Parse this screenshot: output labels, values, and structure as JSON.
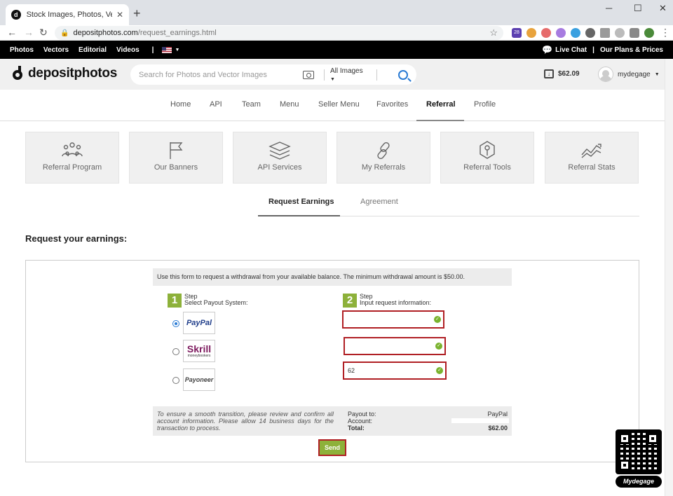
{
  "browser": {
    "tab_title": "Stock Images, Photos, Vectors, Illu",
    "tab_close": "✕",
    "new_tab": "+",
    "url_domain": "depositphotos.com",
    "url_path": "/request_earnings.html",
    "ext_badge": "28"
  },
  "topstrip": {
    "links": [
      "Photos",
      "Vectors",
      "Editorial",
      "Videos"
    ],
    "separator": "|",
    "live_chat": "Live Chat",
    "plans": "Our Plans & Prices"
  },
  "header": {
    "logo": "depositphotos",
    "search_placeholder": "Search for Photos and Vector Images",
    "filter": "All Images",
    "balance": "$62.09",
    "username": "mydegage"
  },
  "nav": {
    "items": [
      "Home",
      "API",
      "Team",
      "Menu",
      "Seller Menu",
      "Favorites",
      "Referral",
      "Profile"
    ],
    "active": "Referral"
  },
  "cards": [
    {
      "label": "Referral Program",
      "icon": "people-icon"
    },
    {
      "label": "Our Banners",
      "icon": "flag-icon"
    },
    {
      "label": "API Services",
      "icon": "layers-icon"
    },
    {
      "label": "My Referrals",
      "icon": "link-icon"
    },
    {
      "label": "Referral Tools",
      "icon": "tools-icon"
    },
    {
      "label": "Referral Stats",
      "icon": "chart-icon"
    }
  ],
  "subtabs": {
    "request": "Request Earnings",
    "agreement": "Agreement"
  },
  "form": {
    "heading": "Request your earnings:",
    "notice": "Use this form to request a withdrawal from your available balance. The minimum withdrawal amount is $50.00.",
    "step1": {
      "num": "1",
      "label": "Step",
      "desc": "Select Payout System:"
    },
    "step2": {
      "num": "2",
      "label": "Step",
      "desc": "Input request information:"
    },
    "payout_systems": [
      "PayPal",
      "Skrill",
      "Payoneer"
    ],
    "skrill_sub": "moneybookers",
    "selected": "PayPal",
    "amount_value": "62",
    "summary_note": "To ensure a smooth transition, please review and confirm all account information. Please allow 14 business days for the transaction to process.",
    "payout_to_label": "Payout to:",
    "payout_to_value": "PayPal",
    "account_label": "Account:",
    "total_label": "Total:",
    "total_value": "$62.00",
    "send": "Send"
  },
  "watermark": "Mydegage",
  "colors": {
    "accent_green": "#8db13a",
    "field_border": "#b01f24",
    "link_blue": "#2a7bd4"
  }
}
